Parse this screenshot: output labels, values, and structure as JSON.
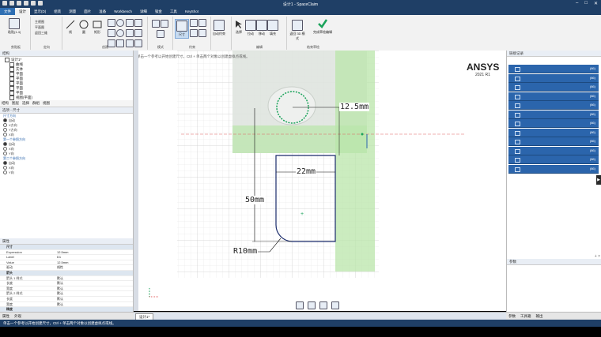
{
  "window": {
    "title": "设计1 - SpaceClaim"
  },
  "menu_tabs": [
    "文件",
    "设计",
    "显示(D)",
    "组装",
    "测量",
    "面片",
    "准备",
    "Workbench",
    "详细",
    "钣金",
    "工具",
    "KeyShot"
  ],
  "ribbon": {
    "groups": [
      "剪贴板",
      "定向",
      "创建",
      "模式",
      "相交",
      "约束",
      "编辑",
      "结束草绘"
    ],
    "paste_label": "粘贴(1.4)",
    "orient_items": [
      "主视图",
      "平面图",
      "返回三维"
    ],
    "create_items": [
      "线",
      "圆",
      "矩形"
    ],
    "dimension_label": "尺寸",
    "edit_items": [
      "选择",
      "拉动",
      "移动",
      "填充",
      "相切"
    ],
    "assist_label": "自动约束",
    "finish_label": "完成草绘编辑",
    "return_label": "返回 3D 模式"
  },
  "structure": {
    "title": "结构",
    "tree": [
      "设计1*",
      "曲线",
      "实体",
      "平面",
      "平面",
      "平面",
      "平面",
      "平面",
      "视图(平面)"
    ],
    "tabs": [
      "结构",
      "图层",
      "选择",
      "群组",
      "视图"
    ]
  },
  "options": {
    "title": "选项 - 尺寸",
    "section1": "尺寸方向",
    "s1_items": [
      "自动",
      "X方向",
      "Y方向",
      "X向"
    ],
    "section2": "第一个参照方向",
    "s2_items": [
      "自动",
      "X向",
      "Y向"
    ],
    "section3": "第二个参照方向",
    "s3_items": [
      "自动",
      "X向",
      "Y向"
    ]
  },
  "properties": {
    "title": "属性",
    "rows": [
      {
        "k": "尺寸",
        "v": "",
        "sec": true
      },
      {
        "k": "Expression",
        "v": "12.5mm"
      },
      {
        "k": "Label",
        "v": "D1"
      },
      {
        "k": "Value",
        "v": "12.5mm"
      },
      {
        "k": "驱动",
        "v": "线性"
      },
      {
        "k": "箭头",
        "v": "",
        "sec": true
      },
      {
        "k": "箭头 1 样式",
        "v": "默认"
      },
      {
        "k": "长度",
        "v": "默认"
      },
      {
        "k": "宽度",
        "v": "默认"
      },
      {
        "k": "箭头 2 样式",
        "v": "默认"
      },
      {
        "k": "长度",
        "v": "默认"
      },
      {
        "k": "宽度",
        "v": "默认"
      },
      {
        "k": "精度",
        "v": "",
        "sec": true
      },
      {
        "k": "小数位数",
        "v": "默认"
      }
    ],
    "tabs": [
      "属性",
      "外观"
    ]
  },
  "canvas": {
    "hint": "单击一个参考以开始创建尺寸，Ctrl + 单击两个对象以创建虚拟点或线。",
    "dims": [
      "12.5mm",
      "22mm",
      "50mm",
      "R10mm"
    ],
    "brand": "ANSYS",
    "brand_sub": "2021 R1",
    "doc_tab": "设计1*"
  },
  "history": {
    "title": "链接记录",
    "counts": [
      "(86)",
      "(86)",
      "(86)",
      "(86)",
      "(86)",
      "(86)",
      "(86)",
      "(86)",
      "(86)",
      "(86)",
      "(86)",
      "(86)"
    ]
  },
  "params": {
    "title": "参数"
  },
  "right_tabs": [
    "参数",
    "工具箱",
    "输出"
  ],
  "status": {
    "text": "单击一个参考以开始创建尺寸，Ctrl + 单击两个对象以创建虚拟点或线。"
  },
  "colors": {
    "accent": "#1f3f66",
    "history_row": "#2b65ac",
    "sketch_green": "#1aa35a",
    "fill_green": "#b9e6a9"
  }
}
